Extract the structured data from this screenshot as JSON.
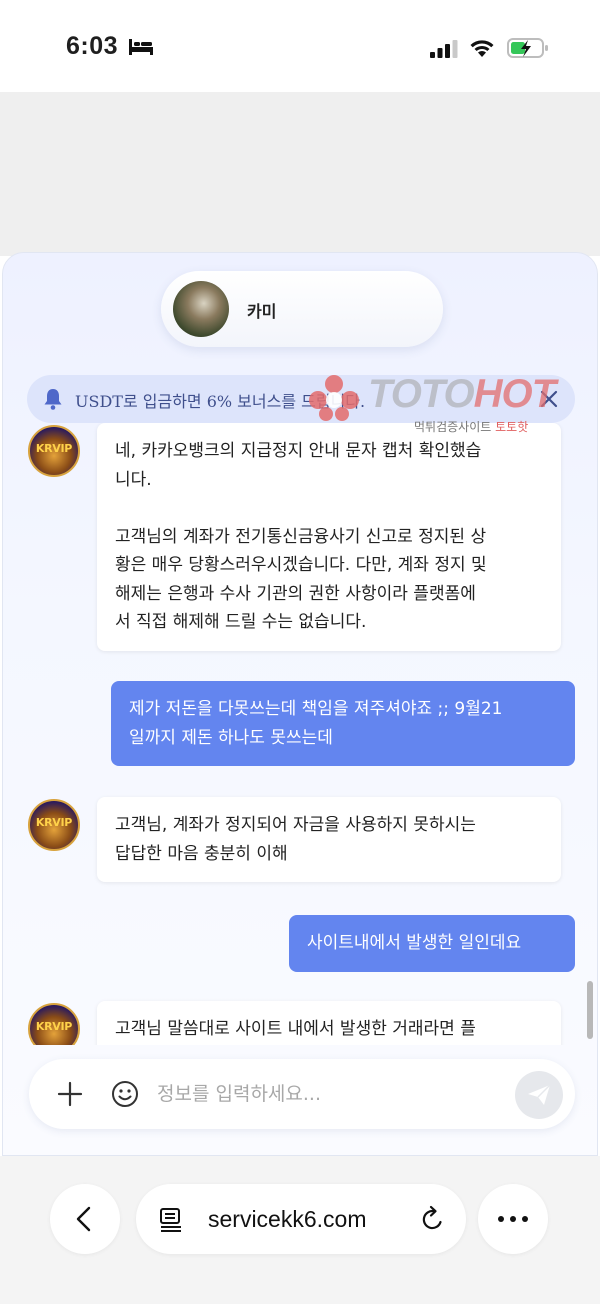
{
  "status_bar": {
    "time": "6:03"
  },
  "agent": {
    "name": "카미"
  },
  "notice": {
    "text": "USDT로 입금하면 6% 보너스를 드립니다."
  },
  "messages": [
    {
      "from": "bot",
      "text": "네, 카카오뱅크의 지급정지 안내 문자 캡처 확인했습\n니다.\n\n고객님의 계좌가 전기통신금융사기 신고로 정지된 상\n황은 매우 당황스러우시겠습니다. 다만, 계좌 정지 및\n해제는 은행과 수사 기관의 권한 사항이라 플랫폼에\n서 직접 해제해 드릴 수는 없습니다."
    },
    {
      "from": "user",
      "text": "제가 저돈을 다못쓰는데 책임을 져주셔야죠 ;; 9월21\n일까지 제돈 하나도 못쓰는데"
    },
    {
      "from": "bot",
      "text": "고객님, 계좌가 정지되어 자금을 사용하지 못하시는\n답답한 마음 충분히 이해"
    },
    {
      "from": "user",
      "text": "사이트내에서 발생한 일인데요"
    },
    {
      "from": "bot",
      "text": "고객님 말씀대로 사이트 내에서 발생한 거래라면 플"
    }
  ],
  "bot_avatar_label": "KRVIP",
  "watermark": {
    "brand_part1": "TOTO",
    "brand_part2": "HOT",
    "sub_part1": "먹튀검증사이트",
    "sub_part2": "토토핫"
  },
  "input": {
    "placeholder": "정보를 입력하세요..."
  },
  "browser": {
    "url": "servicekk6.com"
  },
  "colors": {
    "user_bubble": "#6385ef",
    "notice_bg": "#dde4fb",
    "notice_text": "#3f4f8c"
  },
  "icons": [
    "bed-icon",
    "signal-icon",
    "wifi-icon",
    "battery-charging-icon",
    "bell-icon",
    "close-icon",
    "plus-icon",
    "smile-icon",
    "send-icon",
    "back-icon",
    "page-icon",
    "reload-icon",
    "more-icon"
  ]
}
